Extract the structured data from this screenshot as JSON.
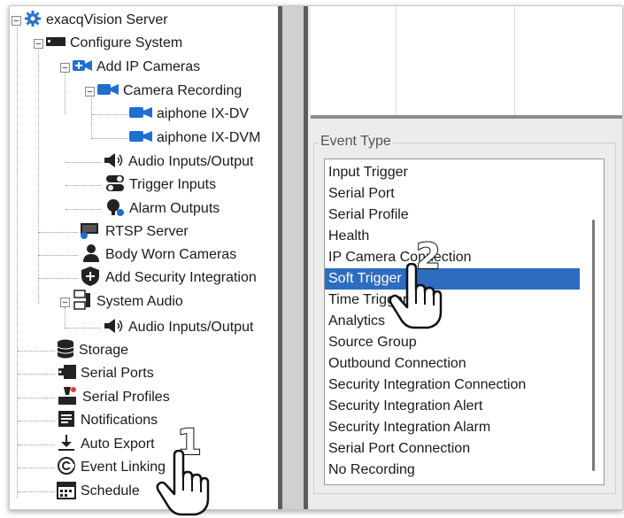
{
  "tree": {
    "items": [
      {
        "label": "exacqVision Server",
        "icon": "gear-icon"
      },
      {
        "label": "Configure System",
        "icon": "server-icon"
      },
      {
        "label": "Add IP Cameras",
        "icon": "add-camera-icon"
      },
      {
        "label": "Camera Recording",
        "icon": "camera-icon"
      },
      {
        "label": "aiphone IX-DV",
        "icon": "camera-icon"
      },
      {
        "label": "aiphone IX-DVM",
        "icon": "camera-icon"
      },
      {
        "label": "Audio Inputs/Output",
        "icon": "speaker-icon"
      },
      {
        "label": "Trigger Inputs",
        "icon": "toggle-icon"
      },
      {
        "label": "Alarm Outputs",
        "icon": "alarm-icon"
      },
      {
        "label": "RTSP Server",
        "icon": "rtsp-icon"
      },
      {
        "label": "Body Worn Cameras",
        "icon": "person-icon"
      },
      {
        "label": "Add Security Integration",
        "icon": "shield-icon"
      },
      {
        "label": "System Audio",
        "icon": "system-audio-icon"
      },
      {
        "label": "Audio Inputs/Output",
        "icon": "speaker-icon"
      },
      {
        "label": "Storage",
        "icon": "database-icon"
      },
      {
        "label": "Serial Ports",
        "icon": "serial-port-icon"
      },
      {
        "label": "Serial Profiles",
        "icon": "serial-profile-icon"
      },
      {
        "label": "Notifications",
        "icon": "notification-icon"
      },
      {
        "label": "Auto Export",
        "icon": "download-icon"
      },
      {
        "label": "Event Linking",
        "icon": "link-icon"
      },
      {
        "label": "Schedule",
        "icon": "calendar-icon"
      }
    ]
  },
  "event_type": {
    "title": "Event Type",
    "items": [
      "Input Trigger",
      "Serial Port",
      "Serial Profile",
      "Health",
      "IP Camera Connection",
      "Soft Trigger",
      "Time Trigger",
      "Analytics",
      "Source Group",
      "Outbound Connection",
      "Security Integration Connection",
      "Security Integration Alert",
      "Security Integration Alarm",
      "Serial Port Connection",
      "No Recording"
    ],
    "selected": "Soft Trigger"
  },
  "callouts": {
    "step1": "1",
    "step2": "2"
  },
  "colors": {
    "selection": "#2d6cc0",
    "camera_blue": "#1f6fd1"
  }
}
